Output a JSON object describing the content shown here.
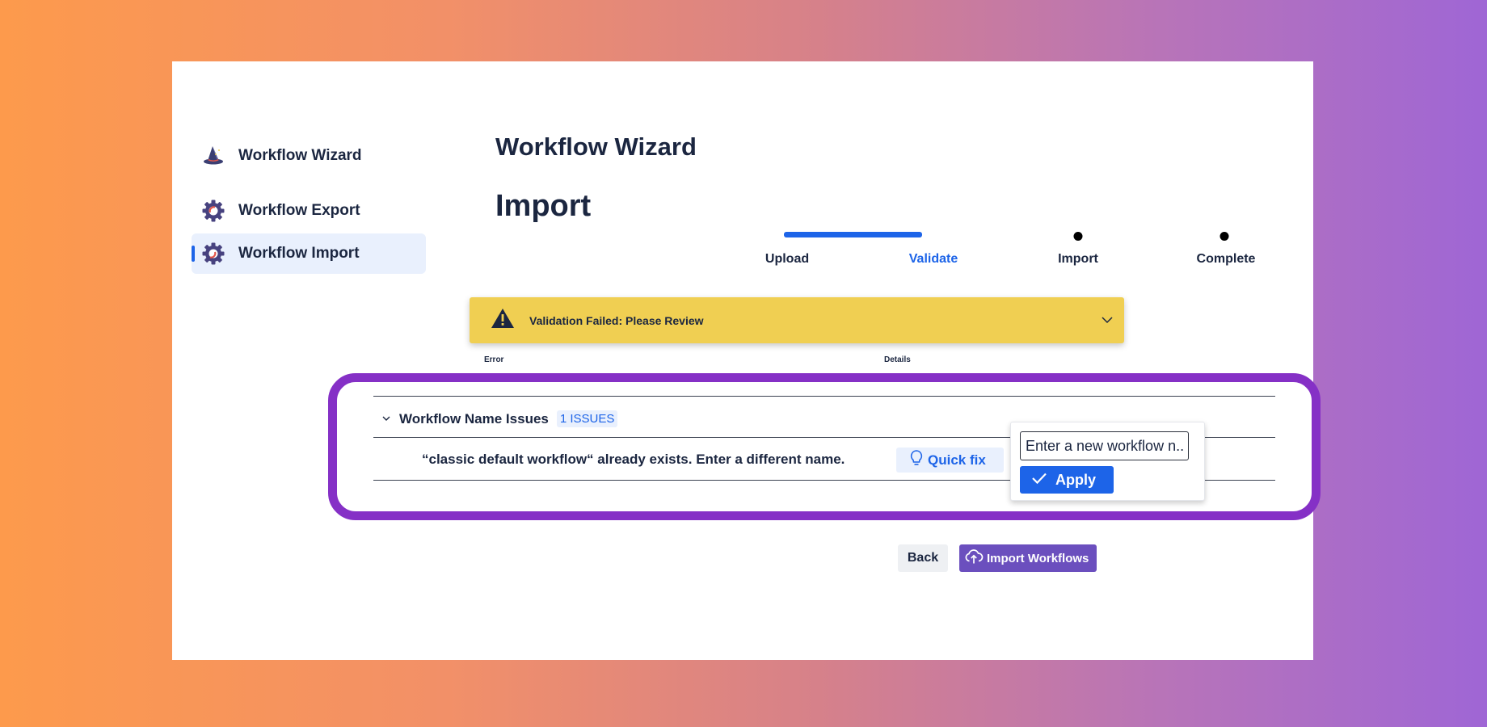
{
  "sidebar": {
    "items": [
      {
        "label": "Workflow Wizard",
        "icon": "wizard-hat-icon"
      },
      {
        "label": "Workflow Export",
        "icon": "gear-icon"
      },
      {
        "label": "Workflow Import",
        "icon": "gear-icon",
        "active": true
      }
    ]
  },
  "header": {
    "title": "Workflow Wizard",
    "subtitle": "Import"
  },
  "stepper": {
    "steps": [
      {
        "label": "Upload",
        "state": "done"
      },
      {
        "label": "Validate",
        "state": "current"
      },
      {
        "label": "Import",
        "state": "pending"
      },
      {
        "label": "Complete",
        "state": "pending"
      }
    ]
  },
  "banner": {
    "text": "Validation Failed: Please Review",
    "icon": "warning-icon"
  },
  "table": {
    "columns": [
      "Error",
      "Details"
    ]
  },
  "issues": {
    "group_title": "Workflow Name Issues",
    "count_badge": "1 ISSUES",
    "error_message": "“classic default workflow“ already exists. Enter a different name.",
    "quick_fix_label": "Quick fix"
  },
  "popover": {
    "input_placeholder": "Enter a new workflow n...",
    "apply_label": "Apply"
  },
  "footer": {
    "back_label": "Back",
    "import_label": "Import Workflows"
  },
  "colors": {
    "accent": "#1d64e8",
    "text": "#1b2640",
    "banner": "#f0cf52",
    "highlight": "#8530c6",
    "import_button": "#6b4fbe"
  }
}
